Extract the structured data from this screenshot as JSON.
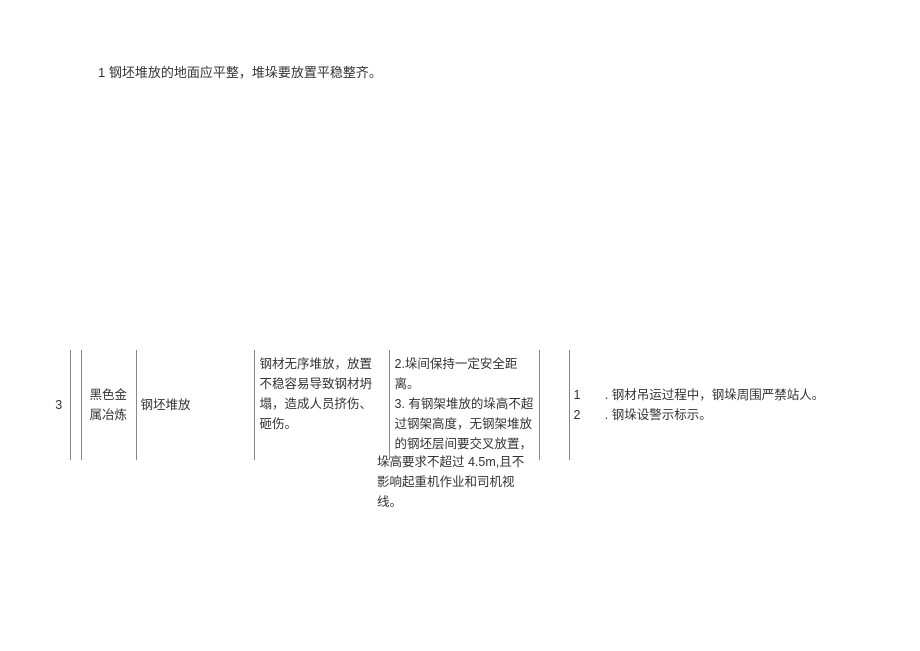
{
  "top_text": "1 钢坯堆放的地面应平整，堆垛要放置平稳整齐。",
  "table": {
    "row": {
      "num": "3",
      "category": "黑色金属冶炼",
      "item": "钢坯堆放",
      "risk": "钢材无序堆放，放置不稳容易导致钢材坍塌，造成人员挤伤、砸伤。",
      "measure1": "2.垛间保持一定安全距离。\n3. 有钢架堆放的垛高不超过钢架高度，无钢架堆放的钢坯层间要交叉放置，",
      "measure2_n1": "1",
      "measure2_t1": ". 钢材吊运过程中，钢垛周围严禁站人。",
      "measure2_n2": "2",
      "measure2_t2": ". 钢垛设警示标示。"
    }
  },
  "extra_para": "垛高要求不超过 4.5m,且不影响起重机作业和司机视线。"
}
